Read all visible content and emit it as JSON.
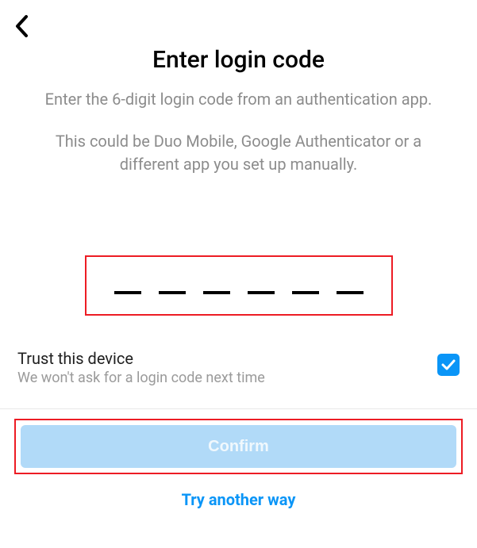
{
  "header": {
    "title": "Enter login code"
  },
  "body": {
    "subtitle1": "Enter the 6-digit login code from an authentication app.",
    "subtitle2": "This could be Duo Mobile, Google Authenticator or a different app you set up manually."
  },
  "code_input": {
    "digit_count": 6,
    "value": ""
  },
  "trust": {
    "title": "Trust this device",
    "subtitle": "We won't ask for a login code next time",
    "checked": true
  },
  "actions": {
    "confirm_label": "Confirm",
    "alt_label": "Try another way"
  },
  "highlights": {
    "code_input_highlighted": true,
    "confirm_highlighted": true,
    "highlight_color": "#ed1c24"
  },
  "icons": {
    "back": "chevron-left",
    "check": "checkmark"
  },
  "colors": {
    "accent": "#0a95f7",
    "muted_text": "#8c8c8c",
    "disabled_btn_bg": "#b1daf8",
    "disabled_btn_text": "#f0f8fd"
  }
}
